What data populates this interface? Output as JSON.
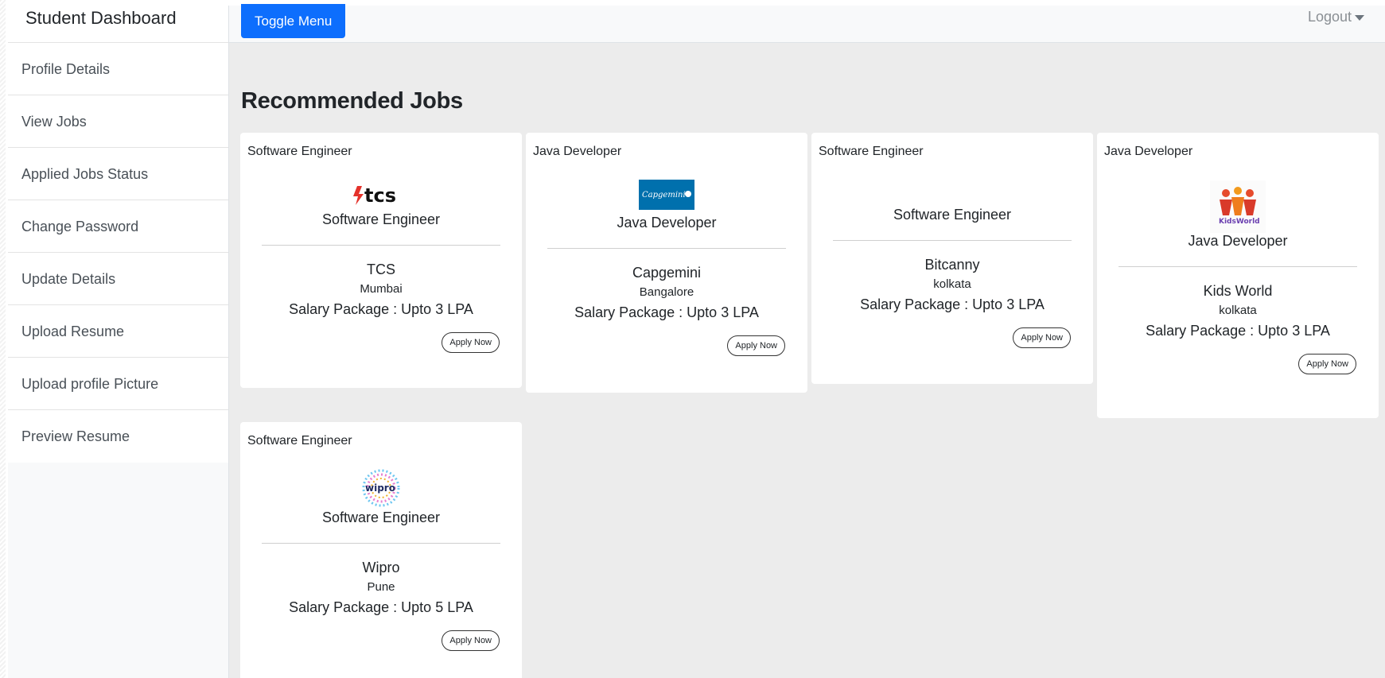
{
  "sidebar": {
    "heading": "Student Dashboard",
    "items": [
      {
        "label": "Profile Details"
      },
      {
        "label": "View Jobs"
      },
      {
        "label": "Applied Jobs Status"
      },
      {
        "label": "Change Password"
      },
      {
        "label": "Update Details"
      },
      {
        "label": "Upload Resume"
      },
      {
        "label": "Upload profile Picture"
      },
      {
        "label": "Preview Resume"
      }
    ]
  },
  "topbar": {
    "toggle_label": "Toggle Menu",
    "logout_label": "Logout"
  },
  "main": {
    "title": "Recommended Jobs",
    "apply_label": "Apply Now",
    "jobs": [
      {
        "header": "Software Engineer",
        "logo": "tcs",
        "logo_text": "tcs",
        "role": "Software Engineer",
        "company": "TCS",
        "location": "Mumbai",
        "salary": "Salary Package : Upto  3  LPA"
      },
      {
        "header": "Java Developer",
        "logo": "capgemini",
        "logo_text": "Capgemini",
        "role": "Java Developer",
        "company": "Capgemini",
        "location": "Bangalore",
        "salary": "Salary Package : Upto  3  LPA"
      },
      {
        "header": "Software Engineer",
        "logo": "none",
        "logo_text": "",
        "role": "Software Engineer",
        "company": "Bitcanny",
        "location": "kolkata",
        "salary": "Salary Package : Upto  3  LPA"
      },
      {
        "header": "Java Developer",
        "logo": "kidsworld",
        "logo_text": "KidsWorld",
        "role": "Java Developer",
        "company": "Kids World",
        "location": "kolkata",
        "salary": "Salary Package : Upto  3  LPA"
      },
      {
        "header": "Software Engineer",
        "logo": "wipro",
        "logo_text": "wipro",
        "role": "Software Engineer",
        "company": "Wipro",
        "location": "Pune",
        "salary": "Salary Package : Upto  5  LPA"
      }
    ]
  },
  "colors": {
    "primary": "#0d6efd",
    "content_bg": "#ececec",
    "tcs_red": "#e4322b",
    "capgemini_blue": "#0070ad"
  }
}
